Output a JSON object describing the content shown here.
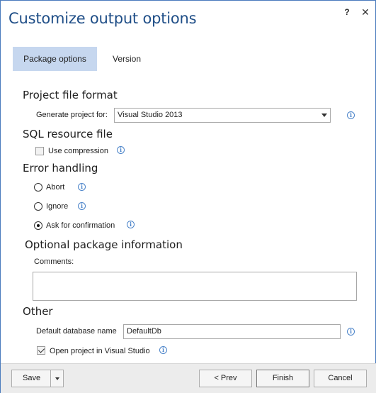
{
  "window": {
    "title": "Customize output options",
    "help_label": "?",
    "close_label": "✕"
  },
  "tabs": [
    {
      "label": "Package options",
      "active": true
    },
    {
      "label": "Version",
      "active": false
    }
  ],
  "project_file_format": {
    "heading": "Project file format",
    "generate_label": "Generate project for:",
    "generate_value": "Visual Studio 2013"
  },
  "sql_resource": {
    "heading": "SQL resource file",
    "use_compression_label": "Use compression",
    "use_compression_checked": false
  },
  "error_handling": {
    "heading": "Error handling",
    "options": [
      {
        "label": "Abort",
        "selected": false
      },
      {
        "label": "Ignore",
        "selected": false
      },
      {
        "label": "Ask for confirmation",
        "selected": true
      }
    ]
  },
  "optional_info": {
    "heading": "Optional package information",
    "comments_label": "Comments:",
    "comments_value": ""
  },
  "other": {
    "heading": "Other",
    "default_db_label": "Default database name",
    "default_db_value": "DefaultDb",
    "open_project_label": "Open project in Visual Studio",
    "open_project_checked": true
  },
  "footer": {
    "save_label": "Save",
    "prev_label": "< Prev",
    "finish_label": "Finish",
    "cancel_label": "Cancel"
  },
  "colors": {
    "title": "#1f4e87",
    "active_tab": "#c6d7ef",
    "info_icon": "#4a83c9",
    "footer_bg": "#ececec"
  },
  "icons": {
    "info": "info-icon",
    "dropdown": "chevron-down-icon"
  }
}
